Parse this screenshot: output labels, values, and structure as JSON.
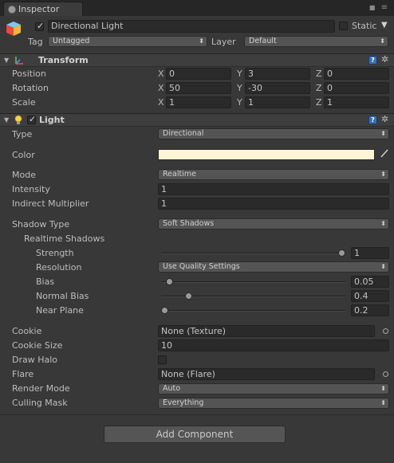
{
  "window": {
    "tab_title": "Inspector"
  },
  "gameobject": {
    "name": "Directional Light",
    "static_label": "Static",
    "tag_label": "Tag",
    "tag_value": "Untagged",
    "layer_label": "Layer",
    "layer_value": "Default"
  },
  "transform": {
    "title": "Transform",
    "position_label": "Position",
    "rotation_label": "Rotation",
    "scale_label": "Scale",
    "axis_x": "X",
    "axis_y": "Y",
    "axis_z": "Z",
    "position": {
      "x": "0",
      "y": "3",
      "z": "0"
    },
    "rotation": {
      "x": "50",
      "y": "-30",
      "z": "0"
    },
    "scale": {
      "x": "1",
      "y": "1",
      "z": "1"
    }
  },
  "light": {
    "title": "Light",
    "type_label": "Type",
    "type_value": "Directional",
    "color_label": "Color",
    "color_value": "#fff4d6",
    "mode_label": "Mode",
    "mode_value": "Realtime",
    "intensity_label": "Intensity",
    "intensity_value": "1",
    "indirect_label": "Indirect Multiplier",
    "indirect_value": "1",
    "shadow_type_label": "Shadow Type",
    "shadow_type_value": "Soft Shadows",
    "realtime_shadows_label": "Realtime Shadows",
    "strength_label": "Strength",
    "strength_value": "1",
    "strength_level": 1.0,
    "resolution_label": "Resolution",
    "resolution_value": "Use Quality Settings",
    "bias_label": "Bias",
    "bias_value": "0.05",
    "bias_level": 0.025,
    "normal_bias_label": "Normal Bias",
    "normal_bias_value": "0.4",
    "normal_bias_level": 0.133,
    "near_plane_label": "Near Plane",
    "near_plane_value": "0.2",
    "near_plane_level": 0.0,
    "cookie_label": "Cookie",
    "cookie_value": "None (Texture)",
    "cookie_size_label": "Cookie Size",
    "cookie_size_value": "10",
    "draw_halo_label": "Draw Halo",
    "flare_label": "Flare",
    "flare_value": "None (Flare)",
    "render_mode_label": "Render Mode",
    "render_mode_value": "Auto",
    "culling_mask_label": "Culling Mask",
    "culling_mask_value": "Everything"
  },
  "footer": {
    "add_component_label": "Add Component"
  },
  "icons": {
    "dropdown_arrow": "▾",
    "foldout": "▼",
    "check": "✓",
    "help": "?",
    "gear": "✲",
    "eyedropper": "/",
    "lock": "🔒",
    "menu": "≡"
  }
}
